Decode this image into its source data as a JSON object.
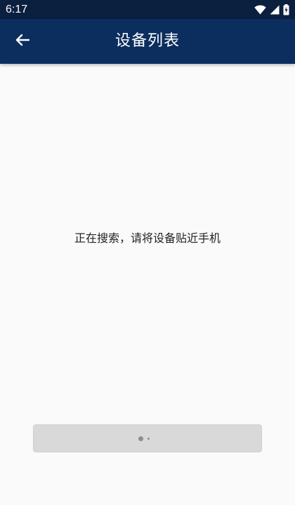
{
  "status_bar": {
    "time": "6:17",
    "icons": [
      "wifi-icon",
      "signal-icon",
      "battery-charging-icon"
    ]
  },
  "app_bar": {
    "title": "设备列表",
    "back_icon": "arrow-left-icon"
  },
  "main": {
    "search_hint": "正在搜索，请将设备贴近手机"
  },
  "loading_button": {
    "state": "loading",
    "indicator": "dots-loading-indicator"
  },
  "colors": {
    "status_bar_bg": "#0b1f3f",
    "app_bar_bg": "#0b2e5e",
    "page_bg": "#fafafa",
    "button_bg": "#d9d9d9",
    "text": "#222222"
  }
}
